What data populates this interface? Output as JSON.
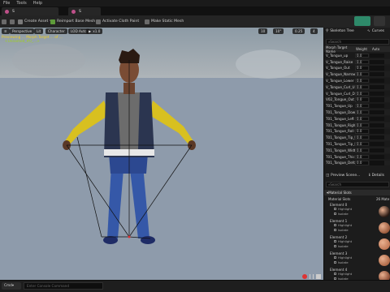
{
  "menu": [
    "File",
    "Tools",
    "Help"
  ],
  "tabs": [
    {
      "label": "S"
    },
    {
      "label": "S"
    }
  ],
  "toolbar": {
    "create_asset": "Create Asset",
    "reimport": "Reimport Base Mesh",
    "activate_cloth": "Activate Cloth Paint",
    "make_static": "Make Static Mesh"
  },
  "viewport": {
    "btn_perspective": "Perspective",
    "btn_lit": "Lit",
    "btn_character": "Character",
    "btn_lod": "LOD Auto",
    "btn_speed": "x1.0",
    "stat_a": "10",
    "stat_b": "10°",
    "stat_c": "0.25",
    "stat_d": "4",
    "notice_line1": "Previewing ... Morph Target ... of ...",
    "notice_line2": "<Unnamed_#0_...>"
  },
  "panel": {
    "tab_skeleton_tree": "Skeleton Tree",
    "tab_curves": "Curves",
    "search_placeholder": "Search",
    "col_name": "Morph Target Name",
    "col_weight": "Weight",
    "col_auto": "Auto",
    "rows": [
      {
        "name": "V_Tongue_up",
        "weight": "0.0"
      },
      {
        "name": "V_Tongue_Raise",
        "weight": "0.0"
      },
      {
        "name": "V_Tongue_Out",
        "weight": "0.0"
      },
      {
        "name": "V_Tongue_Narrow",
        "weight": "0.0"
      },
      {
        "name": "V_Tongue_Lower",
        "weight": "0.0"
      },
      {
        "name": "V_Tongue_Curl_U",
        "weight": "0.0"
      },
      {
        "name": "V_Tongue_Curl_D",
        "weight": "0.0"
      },
      {
        "name": "V02_Tongue_Out",
        "weight": "0.0"
      },
      {
        "name": "T01_Tongue_Up",
        "weight": "0.0"
      },
      {
        "name": "T01_Tongue_Down",
        "weight": "0.0"
      },
      {
        "name": "T01_Tongue_Left",
        "weight": "0.0"
      },
      {
        "name": "T01_Tongue_Right",
        "weight": "0.0"
      },
      {
        "name": "T01_Tongue_Roll",
        "weight": "0.0"
      },
      {
        "name": "T01_Tongue_Tip_Up",
        "weight": "0.0"
      },
      {
        "name": "T01_Tongue_Tip_D",
        "weight": "0.0"
      },
      {
        "name": "T01_Tongue_Width",
        "weight": "0.0"
      },
      {
        "name": "T01_Tongue_Thick",
        "weight": "0.0"
      },
      {
        "name": "T01_Tongue_Defor",
        "weight": "0.0"
      }
    ],
    "tab_preview_scene": "Preview Scene...",
    "tab_details": "Details",
    "details_search_placeholder": "Search",
    "section_material_slots": "Material Slots",
    "material_slots_label": "Material Slots",
    "material_slots_count": "26 Mate",
    "slots": [
      {
        "title": "Element 0",
        "highlight": "Highlight",
        "isolate": "Isolate"
      },
      {
        "title": "Element 1",
        "highlight": "Highlight",
        "isolate": "Isolate"
      },
      {
        "title": "Element 2",
        "highlight": "Highlight",
        "isolate": "Isolate"
      },
      {
        "title": "Element 3",
        "highlight": "Highlight",
        "isolate": "Isolate"
      },
      {
        "title": "Element 4",
        "highlight": "Highlight",
        "isolate": "Isolate"
      }
    ]
  },
  "bottom": {
    "cmd_label": "Cmd",
    "cmd_placeholder": "Enter Console Command"
  },
  "colors": {
    "accent": "#2e8a6a",
    "notice": "#f0d020",
    "skin_tone": "#8a5a3a"
  }
}
